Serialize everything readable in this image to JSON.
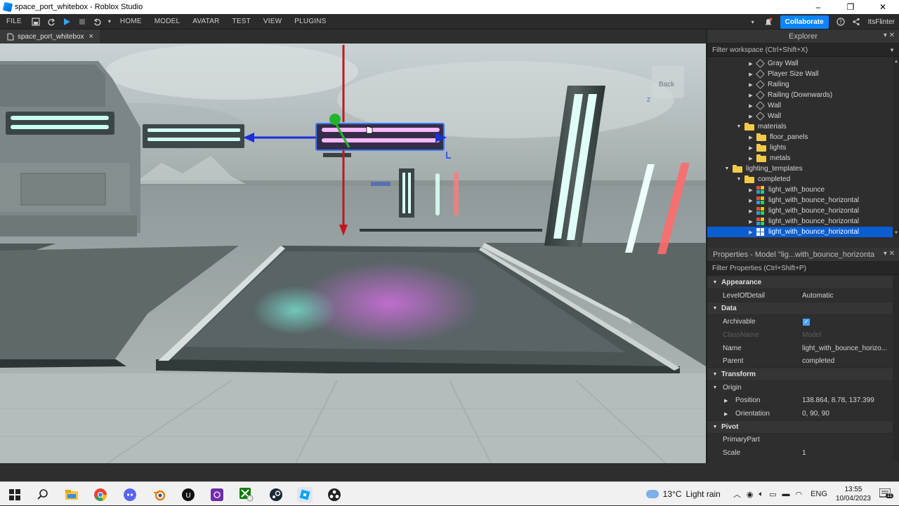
{
  "window": {
    "title": "space_port_whitebox - Roblox Studio",
    "controls": [
      "–",
      "❐",
      "✕"
    ]
  },
  "menubar": {
    "file": "FILE",
    "tabs": [
      "HOME",
      "MODEL",
      "AVATAR",
      "TEST",
      "VIEW",
      "PLUGINS"
    ],
    "collaborate": "Collaborate",
    "user": "ItsFlinter"
  },
  "document_tab": {
    "label": "space_port_whitebox",
    "close": "×"
  },
  "viewport": {
    "back_label": "Back",
    "axis_label": "Z"
  },
  "explorer": {
    "title": "Explorer",
    "filter_placeholder": "Filter workspace (Ctrl+Shift+X)",
    "items": [
      {
        "label": "Gray Wall",
        "icon": "mesh-icon",
        "indent": 4,
        "arrow": "▶"
      },
      {
        "label": "Player Size Wall",
        "icon": "mesh-icon",
        "indent": 4,
        "arrow": "▶"
      },
      {
        "label": "Railing",
        "icon": "mesh-icon",
        "indent": 4,
        "arrow": "▶"
      },
      {
        "label": "Railing (Downwards)",
        "icon": "mesh-icon",
        "indent": 4,
        "arrow": "▶"
      },
      {
        "label": "Wall",
        "icon": "mesh-icon",
        "indent": 4,
        "arrow": "▶"
      },
      {
        "label": "Wall",
        "icon": "mesh-icon",
        "indent": 4,
        "arrow": "▶"
      },
      {
        "label": "materials",
        "icon": "folder-icon",
        "indent": 3,
        "arrow": "▼"
      },
      {
        "label": "floor_panels",
        "icon": "folder-icon",
        "indent": 4,
        "arrow": "▶"
      },
      {
        "label": "lights",
        "icon": "folder-icon",
        "indent": 4,
        "arrow": "▶"
      },
      {
        "label": "metals",
        "icon": "folder-icon",
        "indent": 4,
        "arrow": "▶"
      },
      {
        "label": "lighting_templates",
        "icon": "folder-icon",
        "indent": 2,
        "arrow": "▼"
      },
      {
        "label": "completed",
        "icon": "folder-icon",
        "indent": 3,
        "arrow": "▼"
      },
      {
        "label": "light_with_bounce",
        "icon": "model-icon",
        "indent": 4,
        "arrow": "▶"
      },
      {
        "label": "light_with_bounce_horizontal",
        "icon": "model-icon",
        "indent": 4,
        "arrow": "▶"
      },
      {
        "label": "light_with_bounce_horizontal",
        "icon": "model-icon",
        "indent": 4,
        "arrow": "▶"
      },
      {
        "label": "light_with_bounce_horizontal",
        "icon": "model-icon",
        "indent": 4,
        "arrow": "▶"
      },
      {
        "label": "light_with_bounce_horizontal",
        "icon": "model-icon",
        "indent": 4,
        "arrow": "▶",
        "selected": true
      }
    ]
  },
  "properties": {
    "title": "Properties - Model \"lig...with_bounce_horizontal\"",
    "filter_placeholder": "Filter Properties (Ctrl+Shift+P)",
    "rows": [
      {
        "type": "section",
        "name": "Appearance"
      },
      {
        "type": "prop",
        "name": "LevelOfDetail",
        "value": "Automatic"
      },
      {
        "type": "section",
        "name": "Data"
      },
      {
        "type": "check",
        "name": "Archivable",
        "value": "✓"
      },
      {
        "type": "dim",
        "name": "ClassName",
        "value": "Model"
      },
      {
        "type": "prop",
        "name": "Name",
        "value": "light_with_bounce_horizo..."
      },
      {
        "type": "prop",
        "name": "Parent",
        "value": "completed"
      },
      {
        "type": "section",
        "name": "Transform"
      },
      {
        "type": "group",
        "name": "Origin",
        "value": ""
      },
      {
        "type": "sub",
        "name": "Position",
        "value": "138.864, 8.78, 137.399"
      },
      {
        "type": "sub",
        "name": "Orientation",
        "value": "0, 90, 90"
      },
      {
        "type": "section",
        "name": "Pivot"
      },
      {
        "type": "prop",
        "name": "PrimaryPart",
        "value": ""
      },
      {
        "type": "prop",
        "name": "Scale",
        "value": "1"
      }
    ]
  },
  "taskbar": {
    "temperature": "13°C",
    "weather": "Light rain",
    "language": "ENG",
    "time": "13:55",
    "date": "10/04/2023",
    "notifications": "11"
  },
  "colors": {
    "selection": "#0b5ed2",
    "collaborate": "#0a84ff",
    "panel_bg": "#2e2e2e"
  }
}
